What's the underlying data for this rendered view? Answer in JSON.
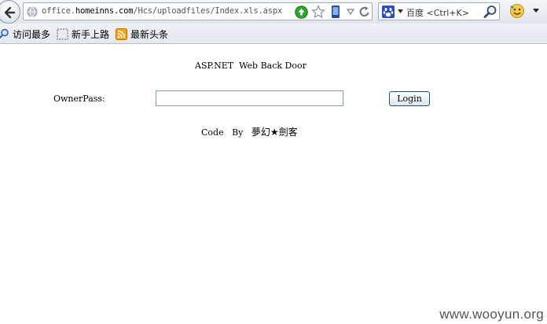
{
  "browser": {
    "url_prefix": "office.",
    "url_domain": "homeinns.com",
    "url_path": "/Hcs/uploadfiles/Index.xls.aspx",
    "search_placeholder": "百度 <Ctrl+K>"
  },
  "bookmarks": [
    {
      "label": "访问最多",
      "icon": "search-icon"
    },
    {
      "label": "新手上路",
      "icon": "blank-page-icon"
    },
    {
      "label": "最新头条",
      "icon": "rss-feed-icon"
    }
  ],
  "page": {
    "title": "ASP.NET  Web Back Door",
    "owner_label": "OwnerPass:",
    "password_value": "",
    "login_label": "Login",
    "credit_prefix": "Code   By   ",
    "credit_author": "夢幻★劍客"
  },
  "watermark": "www.wooyun.org",
  "colors": {
    "input_border": "#7f9db9",
    "button_border": "#1c5180",
    "go_green": "#2ea32e"
  }
}
